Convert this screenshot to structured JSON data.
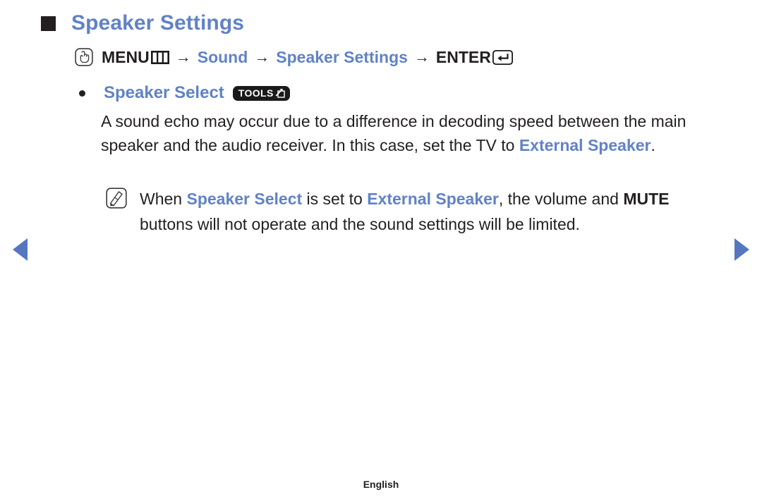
{
  "page": {
    "title": "Speaker Settings",
    "footer_language": "English"
  },
  "menu_path": {
    "menu_icon": "hand-touch-icon",
    "menu_label": "MENU",
    "menu_glyph_icon": "menu-bars-icon",
    "arrow": "→",
    "step_sound": "Sound",
    "step_speaker_settings": "Speaker Settings",
    "enter_label": "ENTER",
    "enter_icon": "enter-return-icon"
  },
  "bullet_item": {
    "label": "Speaker Select",
    "badge_text": "TOOLS",
    "badge_icon": "tools-arrow-icon"
  },
  "body": {
    "part1": "A sound echo may occur due to a difference in decoding speed between the main speaker and the audio receiver. In this case, set the TV to ",
    "highlight1": "External Speaker",
    "part2": "."
  },
  "note": {
    "icon": "note-pencil-icon",
    "part1": "When ",
    "highlight1": "Speaker Select",
    "part2": " is set to ",
    "highlight2": "External Speaker",
    "part3": ", the volume and ",
    "strong1": "MUTE",
    "part4": " buttons will not operate and the sound settings will be limited."
  },
  "nav": {
    "prev_label": "previous-page",
    "next_label": "next-page"
  },
  "colors": {
    "accent_blue": "#6182c8",
    "arrow_blue": "#5477c0",
    "text_dark": "#231f20",
    "badge_black": "#1a1a1a"
  }
}
